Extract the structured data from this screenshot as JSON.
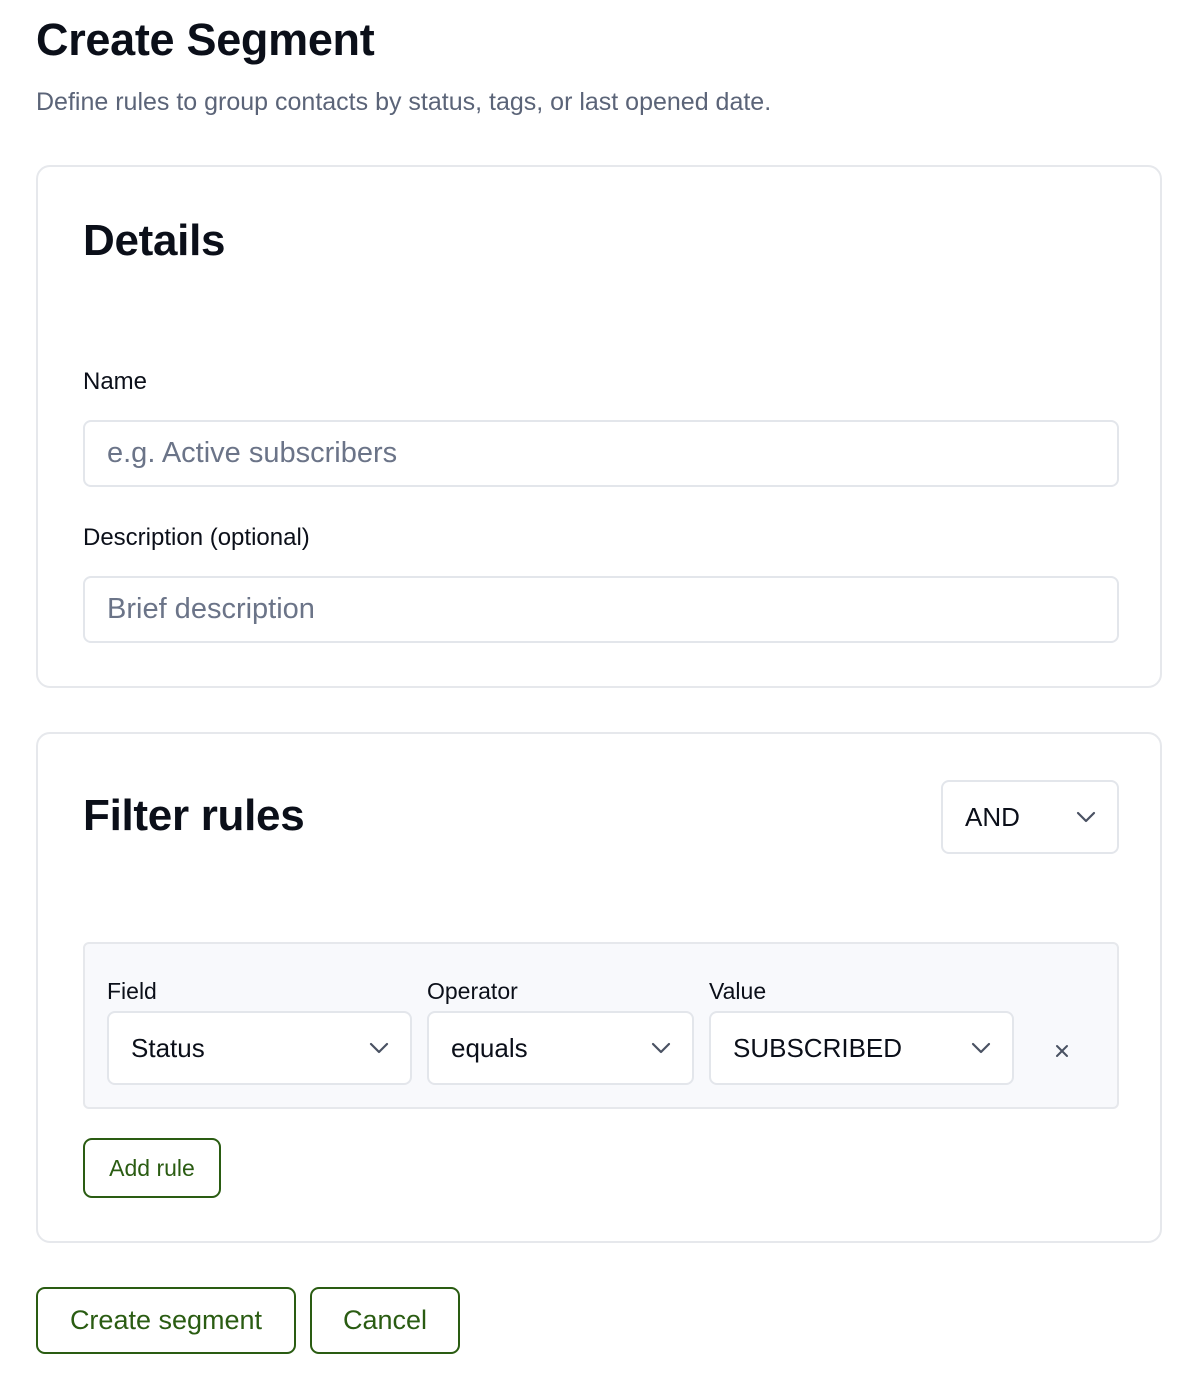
{
  "page": {
    "title": "Create Segment",
    "subtitle": "Define rules to group contacts by status, tags, or last opened date."
  },
  "details": {
    "title": "Details",
    "name_label": "Name",
    "name_placeholder": "e.g. Active subscribers",
    "name_value": "",
    "description_label": "Description (optional)",
    "description_placeholder": "Brief description",
    "description_value": ""
  },
  "filter_rules": {
    "title": "Filter rules",
    "logic_selected": "AND",
    "columns": {
      "field": "Field",
      "operator": "Operator",
      "value": "Value"
    },
    "rules": [
      {
        "field": "Status",
        "operator": "equals",
        "value": "SUBSCRIBED",
        "remove_glyph": "×"
      }
    ],
    "add_rule_label": "Add rule"
  },
  "actions": {
    "create_label": "Create segment",
    "cancel_label": "Cancel"
  },
  "icons": {
    "dropdown": "chevron-down-icon",
    "remove": "close-icon"
  },
  "colors": {
    "accent": "#2a5c12",
    "muted_text": "#5b6478",
    "border": "#e3e6eb",
    "rule_bg": "#f8f9fc"
  }
}
